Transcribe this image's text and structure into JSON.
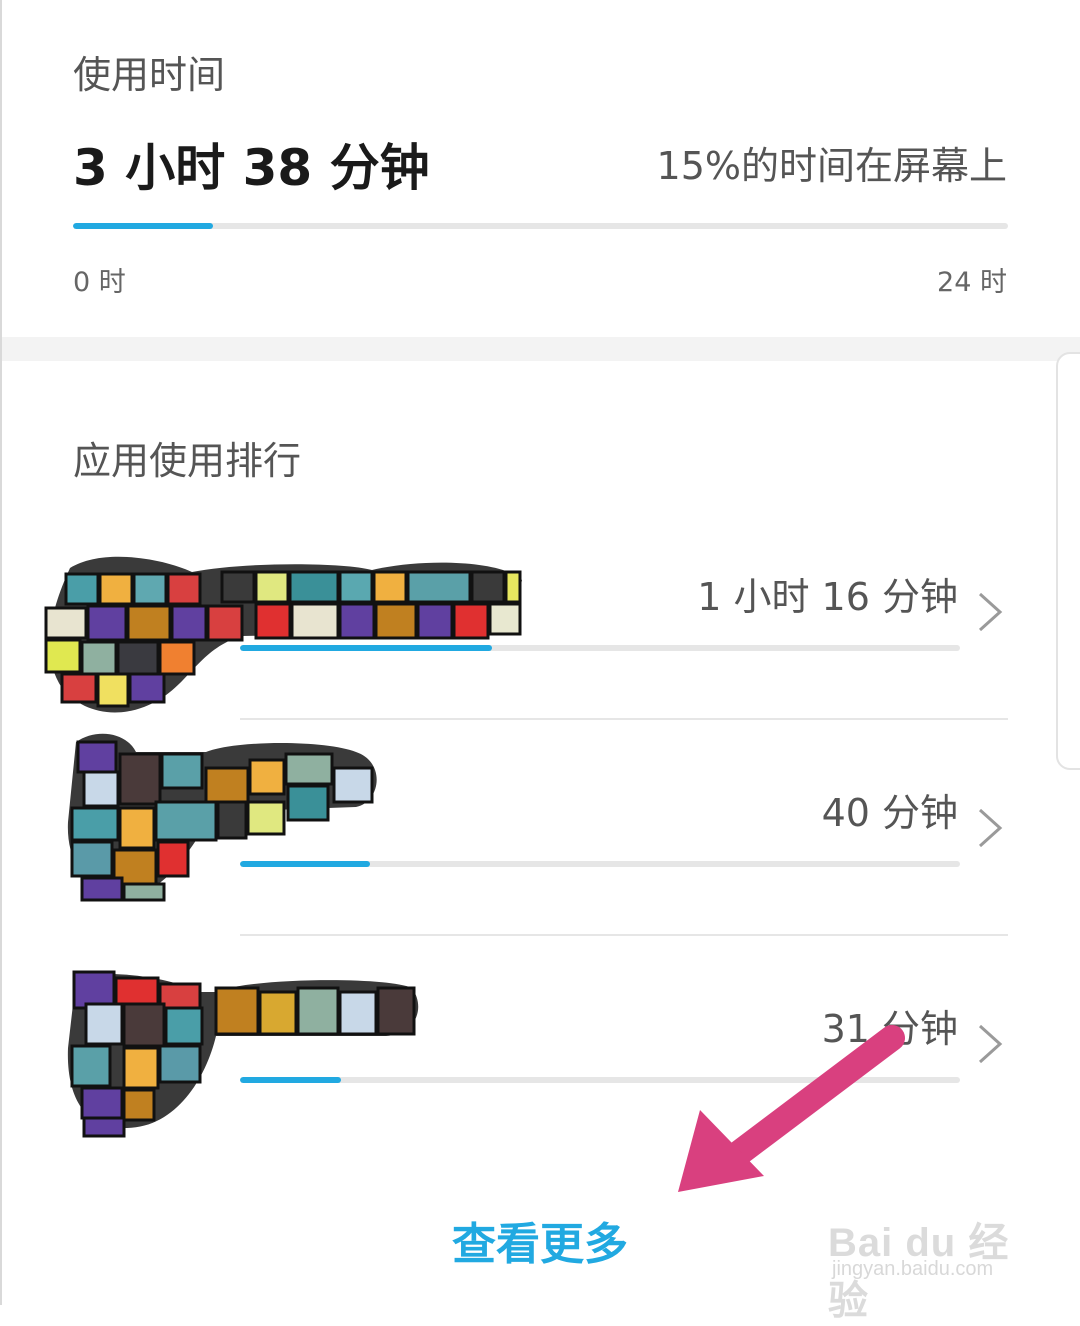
{
  "usage": {
    "title": "使用时间",
    "total": "3 小时 38 分钟",
    "percent_text": "15%的时间在屏幕上",
    "progress": 0.15,
    "scale_min": "0 时",
    "scale_max": "24 时"
  },
  "ranking": {
    "title": "应用使用排行",
    "apps": [
      {
        "time": "1 小时 16 分钟",
        "progress": 0.35
      },
      {
        "time": "40 分钟",
        "progress": 0.18
      },
      {
        "time": "31 分钟",
        "progress": 0.14
      }
    ],
    "see_more": "查看更多"
  },
  "colors": {
    "accent": "#21a9e1",
    "annotation_arrow": "#d9407f"
  },
  "watermark": {
    "brand": "Bai du 经验",
    "domain": "jingyan.baidu.com"
  },
  "icons": [
    "chevron-right-icon",
    "annotation-arrow"
  ]
}
